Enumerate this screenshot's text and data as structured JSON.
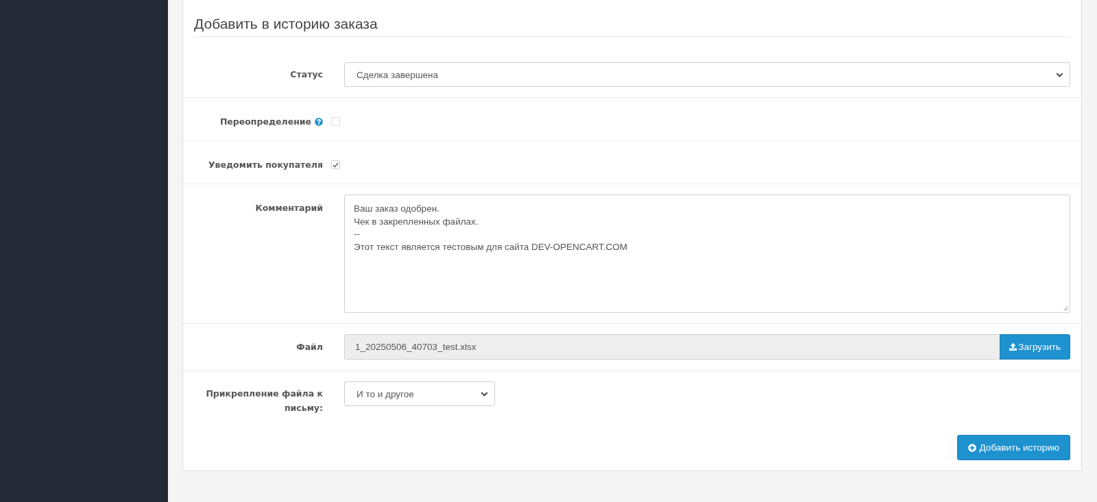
{
  "panel": {
    "title": "Добавить в историю заказа"
  },
  "fields": [
    {
      "kind": "select",
      "label": "Статус",
      "value": "Сделка завершена"
    },
    {
      "kind": "checkbox",
      "label": "Переопределение",
      "help": true,
      "checked": false
    },
    {
      "kind": "checkbox",
      "label": "Уведомить покупателя",
      "help": false,
      "checked": true
    },
    {
      "kind": "textarea",
      "label": "Комментарий",
      "value": "Ваш заказ одобрен.\nЧек в закрепленных файлах.\n--\nЭтот текст является тестовым для сайта DEV-OPENCART.COM"
    },
    {
      "kind": "file",
      "label": "Файл",
      "value": "1_20250506_40703_test.xlsx",
      "button": "Загрузить"
    },
    {
      "kind": "short_select",
      "label": "Прикрепление файла к письму:",
      "value": "И то и другое"
    }
  ],
  "submit_button": "Добавить историю"
}
